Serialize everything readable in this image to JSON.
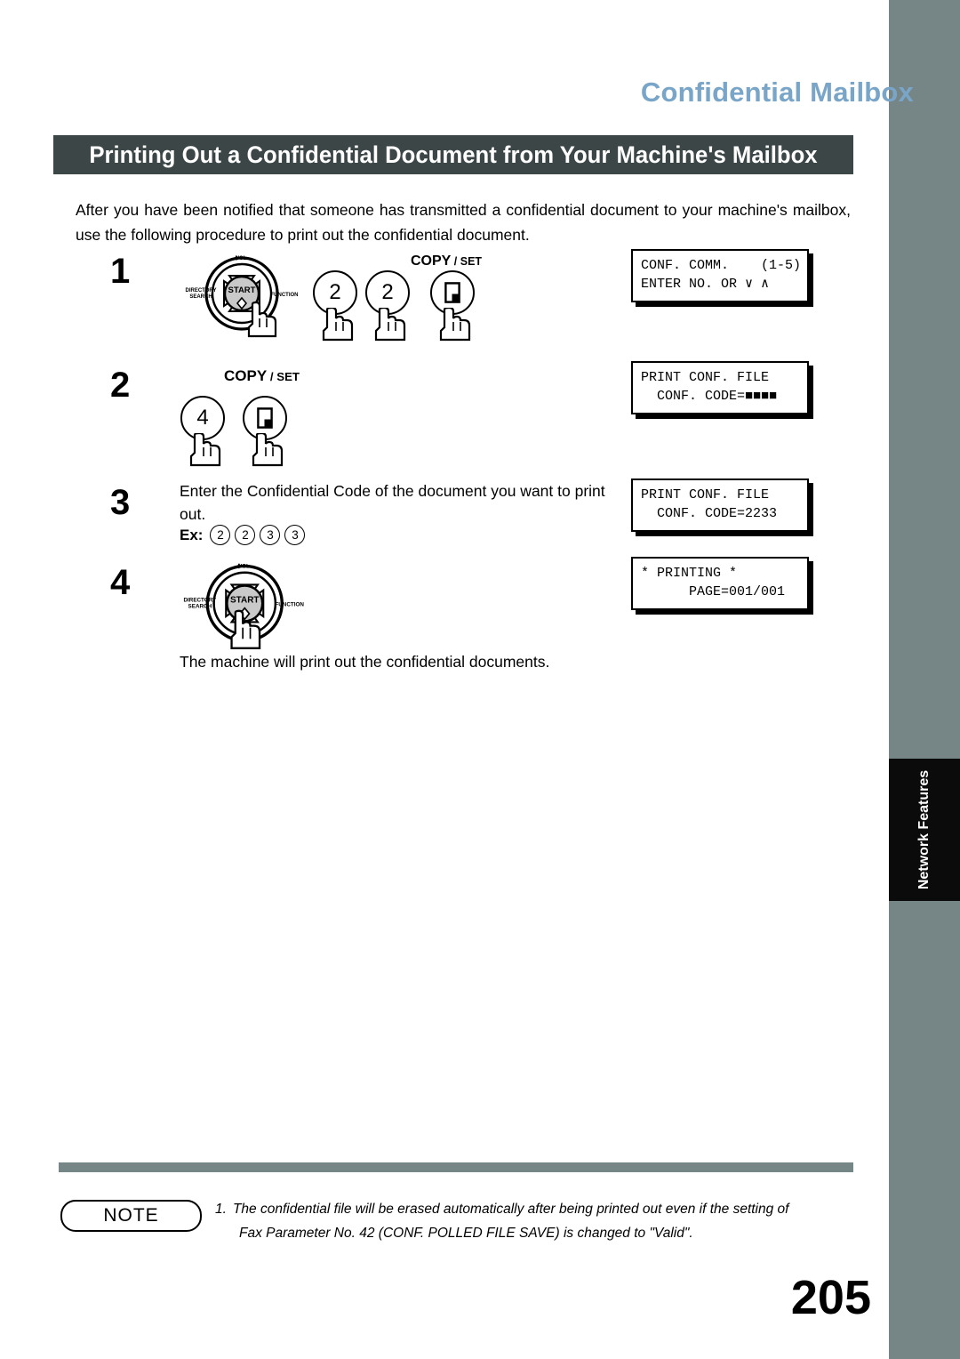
{
  "chapter": {
    "title": "Confidential Mailbox"
  },
  "section": {
    "banner": "Printing Out a Confidential Document from Your Machine's Mailbox"
  },
  "intro": "After you have been notified that someone has transmitted a confidential document to your machine's mailbox, use the following procedure to print out the confidential document.",
  "steps": [
    {
      "number": "1",
      "keys": [
        "nav-right-arrow",
        "2",
        "2",
        "copy-set"
      ],
      "key_labels": {
        "digit1": "2",
        "digit2": "2"
      },
      "copyset_label": {
        "main": "COPY",
        "sep": "/",
        "small": "SET"
      }
    },
    {
      "number": "2",
      "keys": [
        "4",
        "copy-set"
      ],
      "key_labels": {
        "digit1": "4"
      },
      "copyset_label": {
        "main": "COPY",
        "sep": "/",
        "small": "SET"
      }
    },
    {
      "number": "3",
      "text": "Enter the Confidential Code of the document you want to print out.",
      "example_label": "Ex:",
      "example_keys": [
        "2",
        "2",
        "3",
        "3"
      ]
    },
    {
      "number": "4",
      "keys": [
        "start"
      ]
    }
  ],
  "closing_text": "The machine will print out the confidential documents.",
  "dial": {
    "center_label": "START",
    "top_label": "VOL.",
    "left_label_line1": "DIRECTORY",
    "left_label_line2": "SEARCH",
    "right_label": "FUNCTION"
  },
  "lcd_displays": [
    {
      "id": "lcd-1",
      "line1": "CONF. COMM.    (1-5)",
      "line2": "ENTER NO. OR ∨ ∧"
    },
    {
      "id": "lcd-2",
      "line1": "PRINT CONF. FILE",
      "line2": "  CONF. CODE=■■■■"
    },
    {
      "id": "lcd-3",
      "line1": "PRINT CONF. FILE",
      "line2": "  CONF. CODE=2233"
    },
    {
      "id": "lcd-4",
      "line1": "* PRINTING *",
      "line2": "      PAGE=001/001"
    }
  ],
  "side_tab": {
    "label": "Network Features"
  },
  "note": {
    "badge": "NOTE",
    "number": "1.",
    "line1": "The confidential file will be erased automatically after being printed out even if the setting of",
    "line2": "Fax Parameter No. 42 (CONF. POLLED FILE SAVE) is changed to \"Valid\"."
  },
  "page_number": "205",
  "colors": {
    "chapter_title": "#79a5c8",
    "banner_bg": "#3c4647",
    "strip": "#768586",
    "side_tab_bg": "#0b0b0b"
  }
}
